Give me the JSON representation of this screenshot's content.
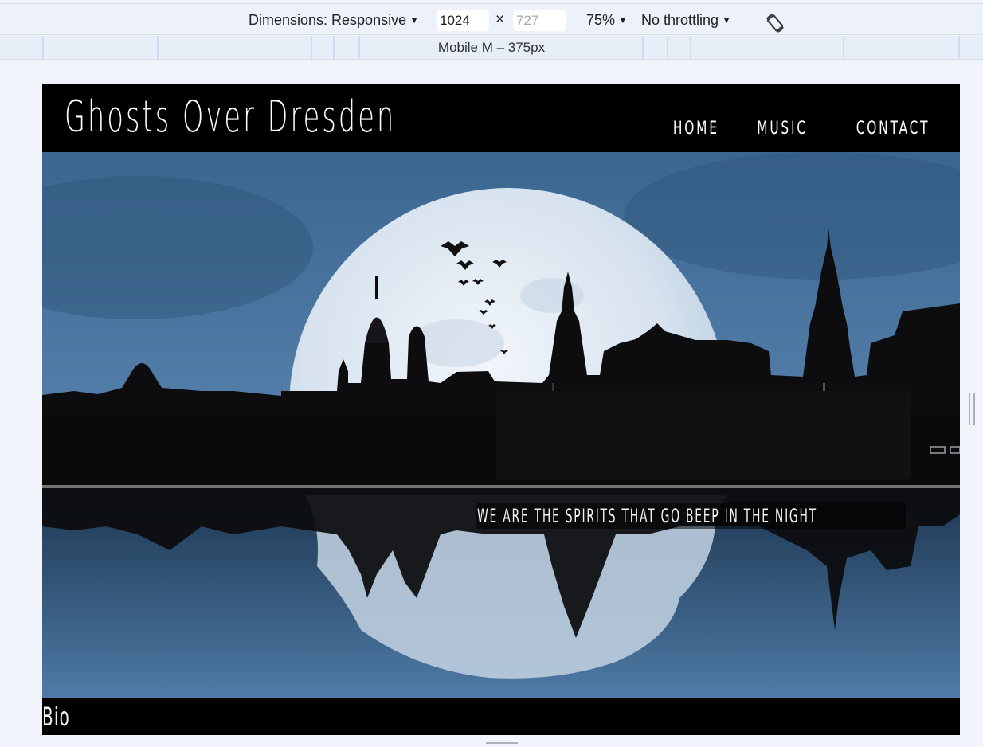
{
  "devtools": {
    "dimensions_label": "Dimensions: Responsive",
    "width_value": "1024",
    "times_sign": "×",
    "height_placeholder": "727",
    "zoom": "75%",
    "throttling": "No throttling",
    "caret": "▼",
    "media_query_label": "Mobile M – 375px",
    "rotate_icon": "rotate-device-icon"
  },
  "site": {
    "title": "Ghosts Over Dresden",
    "nav": [
      "Home",
      "Music",
      "Contact"
    ],
    "tagline": "We are the spirits that go beep in the night",
    "bio_heading": "Bio"
  },
  "colors": {
    "sky": "#3e6b9a",
    "moon": "#dfe8f2",
    "header_bg": "#000000"
  }
}
